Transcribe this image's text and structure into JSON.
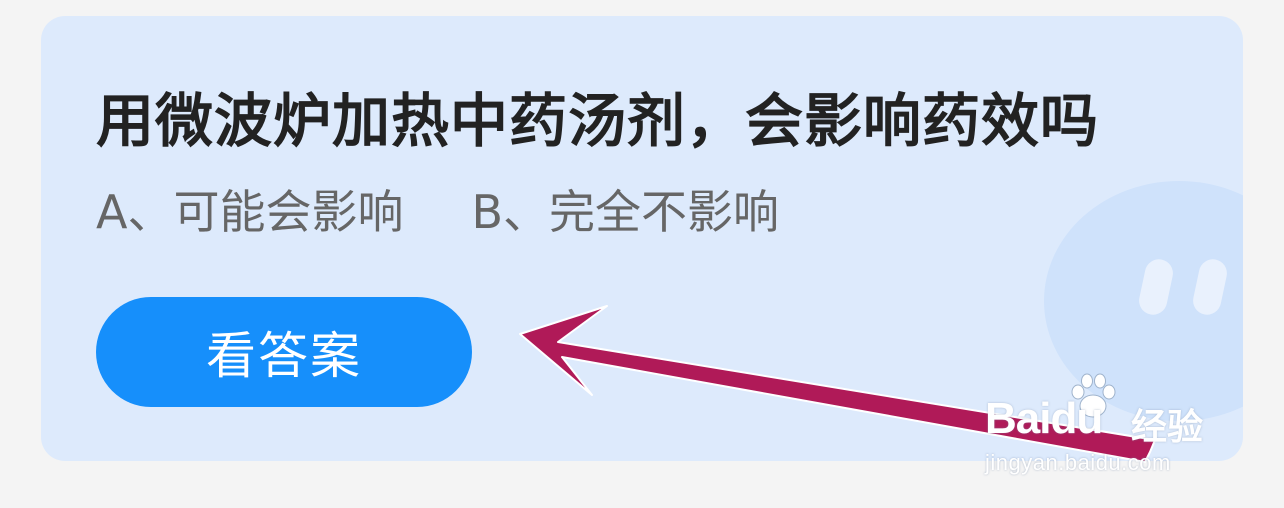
{
  "quiz": {
    "question": "用微波炉加热中药汤剂，会影响药效吗",
    "options": [
      "A、可能会影响",
      "B、完全不影响"
    ],
    "answer_button_label": "看答案"
  },
  "watermark": {
    "brand": "Baidu",
    "brand_cn": "经验",
    "url": "jingyan.baidu.com"
  },
  "colors": {
    "page_background": "#f4f4f4",
    "card_background": "#ddeafc",
    "button_blue": "#168ffb",
    "annotation_arrow": "#b01a58"
  },
  "icons": {
    "mascot": "mascot-face-icon",
    "arrow": "annotation-arrow-icon",
    "paw": "baidu-paw-icon"
  }
}
